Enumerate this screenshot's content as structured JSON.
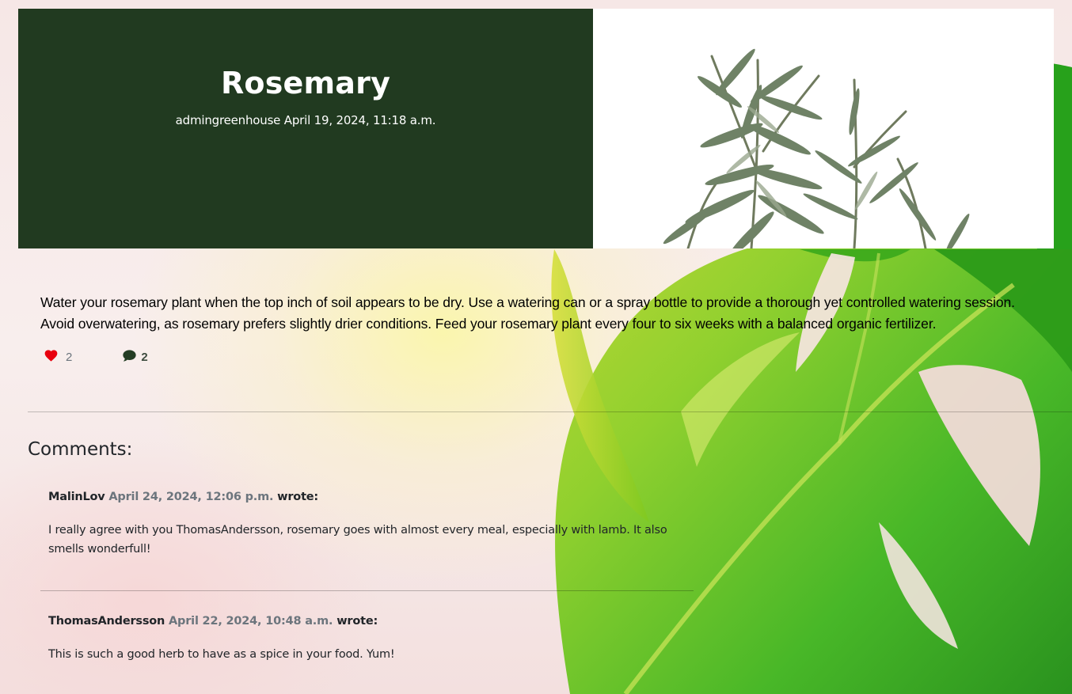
{
  "post": {
    "title": "Rosemary",
    "author": "admingreenhouse",
    "date": "April 19, 2024, 11:18 a.m.",
    "content": "Water your rosemary plant when the top inch of soil appears to be dry. Use a watering can or a spray bottle to provide a thorough yet controlled watering session. Avoid overwatering, as rosemary prefers slightly drier conditions. Feed your rosemary plant every four to six weeks with a balanced organic fertilizer.",
    "like_count": "2",
    "comment_count": "2",
    "like_icon": "heart-icon",
    "comment_icon": "comment-icon",
    "like_color": "#e8000e"
  },
  "comments_section": {
    "heading": "Comments:",
    "wrote_label": "wrote:",
    "items": [
      {
        "author": "MalinLov",
        "date": "April 24, 2024, 12:06 p.m.",
        "body": "I really agree with you ThomasAndersson, rosemary goes with almost every meal, especially with lamb. It also smells wonderfull!"
      },
      {
        "author": "ThomasAndersson",
        "date": "April 22, 2024, 10:48 a.m.",
        "body": "This is such a good herb to have as a spice in your food. Yum!"
      }
    ]
  },
  "theme": {
    "hero_background": "#213a20",
    "muted_text": "#6c757d"
  }
}
